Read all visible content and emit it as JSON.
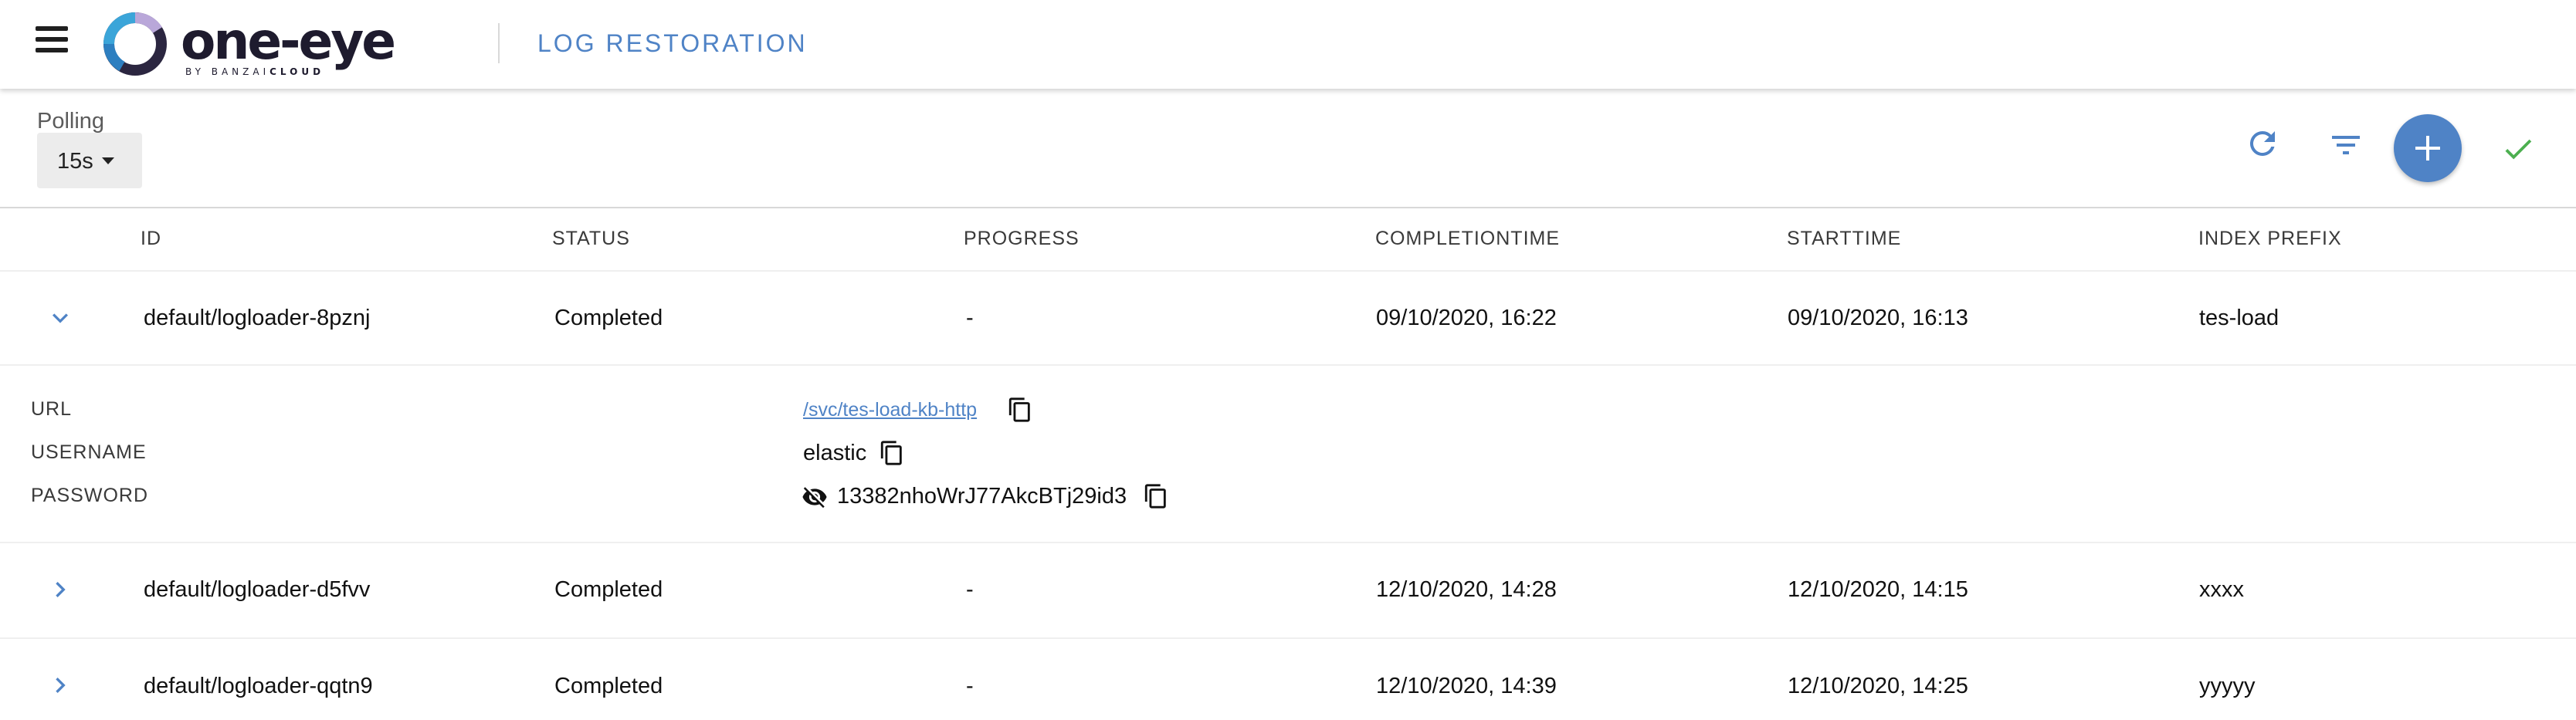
{
  "header": {
    "logo": {
      "wordmark": "one-eye",
      "byline_prefix": "BY BANZAI",
      "byline_suffix": "CLOUD"
    },
    "title": "LOG RESTORATION",
    "menu_icon": "hamburger-menu-icon"
  },
  "toolbar": {
    "polling_label": "Polling",
    "polling_value": "15s",
    "actions": [
      {
        "name": "refresh",
        "icon": "refresh-icon"
      },
      {
        "name": "filter",
        "icon": "filter-icon"
      },
      {
        "name": "add",
        "icon": "plus-icon"
      },
      {
        "name": "confirm",
        "icon": "check-icon"
      }
    ]
  },
  "table": {
    "columns": [
      "ID",
      "STATUS",
      "PROGRESS",
      "COMPLETIONTIME",
      "STARTTIME",
      "INDEX PREFIX"
    ],
    "rows": [
      {
        "id": "default/logloader-8pznj",
        "status": "Completed",
        "progress": "-",
        "completion_time": "09/10/2020, 16:22",
        "start_time": "09/10/2020, 16:13",
        "index_prefix": "tes-load",
        "expanded": true
      },
      {
        "id": "default/logloader-d5fvv",
        "status": "Completed",
        "progress": "-",
        "completion_time": "12/10/2020, 14:28",
        "start_time": "12/10/2020, 14:15",
        "index_prefix": "xxxx",
        "expanded": false
      },
      {
        "id": "default/logloader-qqtn9",
        "status": "Completed",
        "progress": "-",
        "completion_time": "12/10/2020, 14:39",
        "start_time": "12/10/2020, 14:25",
        "index_prefix": "yyyyy",
        "expanded": false
      }
    ],
    "details": {
      "url_label": "URL",
      "url_value": "/svc/tes-load-kb-http",
      "username_label": "USERNAME",
      "username_value": "elastic",
      "password_label": "PASSWORD",
      "password_value": "13382nhoWrJ77AkcBTj29id3"
    }
  },
  "colors": {
    "accent": "#4f83c6",
    "check": "#4caf50",
    "text": "#111111",
    "muted": "#5b5b5b"
  }
}
